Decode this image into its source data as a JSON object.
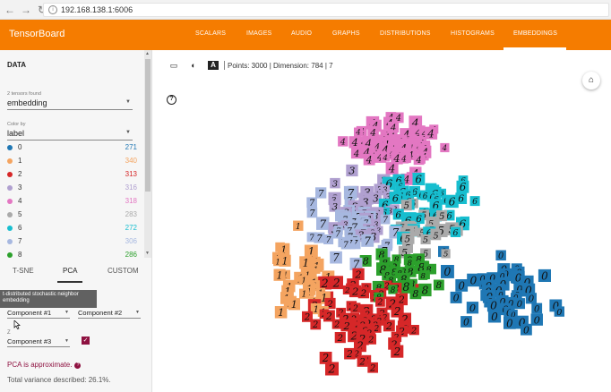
{
  "browser": {
    "url": "192.168.138.1:6006"
  },
  "header": {
    "title": "TensorBoard",
    "tabs": [
      "SCALARS",
      "IMAGES",
      "AUDIO",
      "GRAPHS",
      "DISTRIBUTIONS",
      "HISTOGRAMS",
      "EMBEDDINGS"
    ],
    "active_tab": "EMBEDDINGS",
    "color": "#f57c00"
  },
  "sidebar": {
    "data_title": "DATA",
    "tensors_found_label": "2 tensors found",
    "tensor_value": "embedding",
    "color_by_label": "Color by",
    "color_by_value": "label",
    "legend": [
      {
        "label": "0",
        "count": "271",
        "color": "#1f77b4"
      },
      {
        "label": "1",
        "count": "340",
        "color": "#f4a460"
      },
      {
        "label": "2",
        "count": "313",
        "color": "#d62728"
      },
      {
        "label": "3",
        "count": "316",
        "color": "#b0a0d0"
      },
      {
        "label": "4",
        "count": "318",
        "color": "#e377c2"
      },
      {
        "label": "5",
        "count": "283",
        "color": "#aaaaaa"
      },
      {
        "label": "6",
        "count": "272",
        "color": "#17becf"
      },
      {
        "label": "7",
        "count": "306",
        "color": "#a7b8e0"
      },
      {
        "label": "8",
        "count": "286",
        "color": "#2ca02c"
      }
    ],
    "methods": [
      "T-SNE",
      "PCA",
      "CUSTOM"
    ],
    "active_method": "PCA",
    "tooltip": "t-distributed stochastic neighbor embedding",
    "component_x": "Component #1",
    "component_y": "Component #2",
    "z_label": "Z",
    "component_z": "Component #3",
    "pca_note": "PCA is approximate.",
    "variance": "Total variance described: 26.1%."
  },
  "toolbar": {
    "points_text": "Points: 3000",
    "dimension_text": "Dimension: 784",
    "extra_text": "7"
  }
}
